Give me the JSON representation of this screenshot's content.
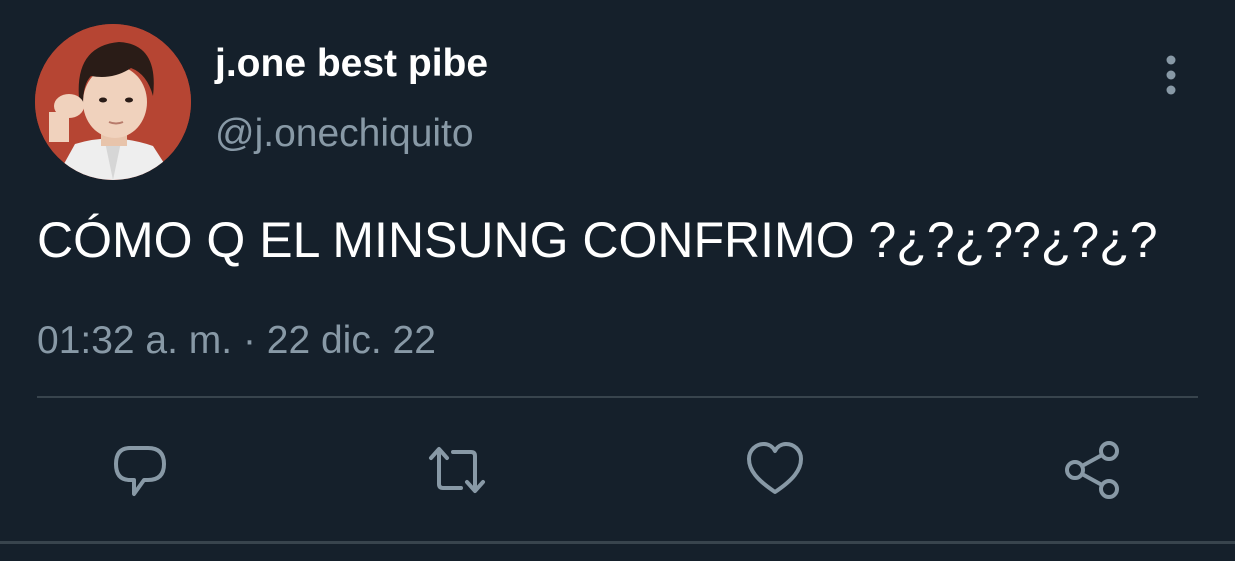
{
  "user": {
    "display_name": "j.one best pibe",
    "handle": "@j.onechiquito"
  },
  "tweet": {
    "text": "CÓMO Q EL MINSUNG CONFRIMO ?¿?¿??¿?¿?",
    "timestamp": "01:32 a. m. · 22 dic. 22"
  },
  "icons": {
    "avatar": "profile-photo",
    "more": "vertical-dots-icon",
    "reply": "reply-icon",
    "retweet": "retweet-icon",
    "like": "heart-icon",
    "share": "share-icon"
  },
  "colors": {
    "background": "#15202b",
    "primary_text": "#ffffff",
    "secondary_text": "#8899a6",
    "divider": "#38444d",
    "avatar_bg": "#b64533"
  }
}
